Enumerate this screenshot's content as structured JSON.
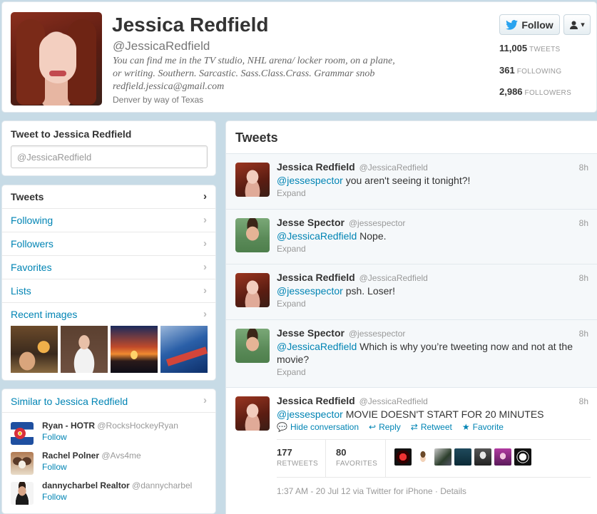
{
  "profile": {
    "name": "Jessica Redfield",
    "handle": "@JessicaRedfield",
    "bio": "You can find me in the TV studio, NHL arena/ locker room, on a plane, or writing. Southern. Sarcastic. Sass.Class.Crass. Grammar snob redfield.jessica@gmail.com",
    "location": "Denver by way of Texas",
    "follow_label": "Follow",
    "stats": [
      {
        "value": "11,005",
        "label": "TWEETS"
      },
      {
        "value": "361",
        "label": "FOLLOWING"
      },
      {
        "value": "2,986",
        "label": "FOLLOWERS"
      }
    ]
  },
  "tweet_to": {
    "title": "Tweet to Jessica Redfield",
    "placeholder": "@JessicaRedfield"
  },
  "nav": {
    "items": [
      {
        "label": "Tweets"
      },
      {
        "label": "Following"
      },
      {
        "label": "Followers"
      },
      {
        "label": "Favorites"
      },
      {
        "label": "Lists"
      },
      {
        "label": "Recent images"
      }
    ]
  },
  "similar": {
    "title": "Similar to Jessica Redfield",
    "users": [
      {
        "name": "Ryan - HOTR",
        "handle": "@RocksHockeyRyan",
        "follow": "Follow"
      },
      {
        "name": "Rachel Polner",
        "handle": "@Avs4me",
        "follow": "Follow"
      },
      {
        "name": "dannycharbel Realtor",
        "handle": "@dannycharbel",
        "follow": "Follow"
      }
    ]
  },
  "timeline": {
    "title": "Tweets",
    "tweets": [
      {
        "name": "Jessica Redfield",
        "handle": "@JessicaRedfield",
        "time": "8h",
        "mention": "@jessespector",
        "text": " you aren't seeing it tonight?!",
        "expand": "Expand"
      },
      {
        "name": "Jesse Spector",
        "handle": "@jessespector",
        "time": "8h",
        "mention": "@JessicaRedfield",
        "text": " Nope.",
        "expand": "Expand"
      },
      {
        "name": "Jessica Redfield",
        "handle": "@JessicaRedfield",
        "time": "8h",
        "mention": "@jessespector",
        "text": " psh. Loser!",
        "expand": "Expand"
      },
      {
        "name": "Jesse Spector",
        "handle": "@jessespector",
        "time": "8h",
        "mention": "@JessicaRedfield",
        "text": " Which is why you’re tweeting now and not at the movie?",
        "expand": "Expand"
      },
      {
        "name": "Jessica Redfield",
        "handle": "@JessicaRedfield",
        "time": "8h",
        "mention": "@jessespector",
        "text": " MOVIE DOESN'T START FOR 20 MINUTES"
      }
    ],
    "actions": {
      "hide": "Hide conversation",
      "reply": "Reply",
      "retweet": "Retweet",
      "favorite": "Favorite"
    },
    "retweets": {
      "value": "177",
      "label": "RETWEETS"
    },
    "favorites": {
      "value": "80",
      "label": "FAVORITES"
    },
    "meta": "1:37 AM - 20 Jul 12 via Twitter for iPhone · Details"
  }
}
